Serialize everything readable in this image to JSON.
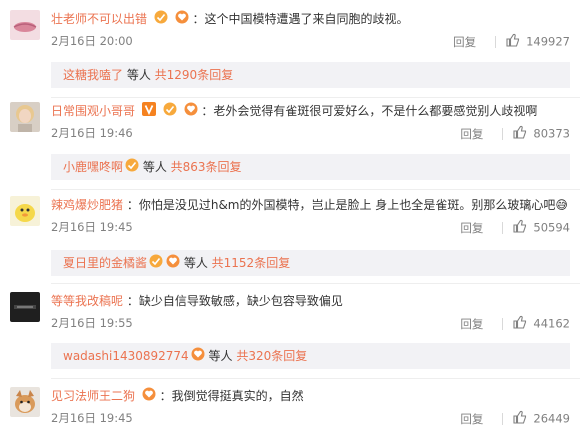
{
  "comments": [
    {
      "username": "壮老师不可以出错",
      "text": "：这个中国模特遭遇了来自同胞的歧视。",
      "time": "2月16日 20:00",
      "reply_label": "回复",
      "likes": "149927",
      "sub": {
        "name": "这糖我嗑了",
        "suffix": " 等人 ",
        "more": "共1290条回复"
      },
      "avatar_icon": "pink-lips-avatar"
    },
    {
      "username": "日常围观小哥哥",
      "text": "：老外会觉得有雀斑很可爱好么，不是什么都要感觉别人歧视啊",
      "time": "2月16日 19:46",
      "reply_label": "回复",
      "likes": "80373",
      "sub": {
        "name": "小鹿嘿咚啊",
        "suffix": " 等人 ",
        "more": "共863条回复"
      },
      "avatar_icon": "blonde-person-avatar"
    },
    {
      "username": "辣鸡爆炒肥猪",
      "text": "：你怕是没见过h&m的外国模特，岂止是脸上 身上也全是雀斑。别那么玻璃心吧😅",
      "time": "2月16日 19:45",
      "reply_label": "回复",
      "likes": "50594",
      "sub": {
        "name": "夏日里的金橘酱",
        "suffix": " 等人 ",
        "more": "共1152条回复"
      },
      "avatar_icon": "yellow-duck-avatar"
    },
    {
      "username": "等等我改稿呢",
      "text": "：缺少自信导致敏感，缺少包容导致偏见",
      "time": "2月16日 19:55",
      "reply_label": "回复",
      "likes": "44162",
      "sub": {
        "name": "wadashi1430892774",
        "suffix": " 等人 ",
        "more": "共320条回复"
      },
      "avatar_icon": "dark-logo-avatar"
    },
    {
      "username": "见习法师王二狗",
      "text": "：我倒觉得挺真实的，自然",
      "time": "2月16日 19:45",
      "reply_label": "回复",
      "likes": "26449",
      "avatar_icon": "shiba-dog-avatar"
    }
  ],
  "colors": {
    "username": "#eb7350",
    "subbox_bg": "#f2f2f5",
    "meta": "#808080"
  }
}
